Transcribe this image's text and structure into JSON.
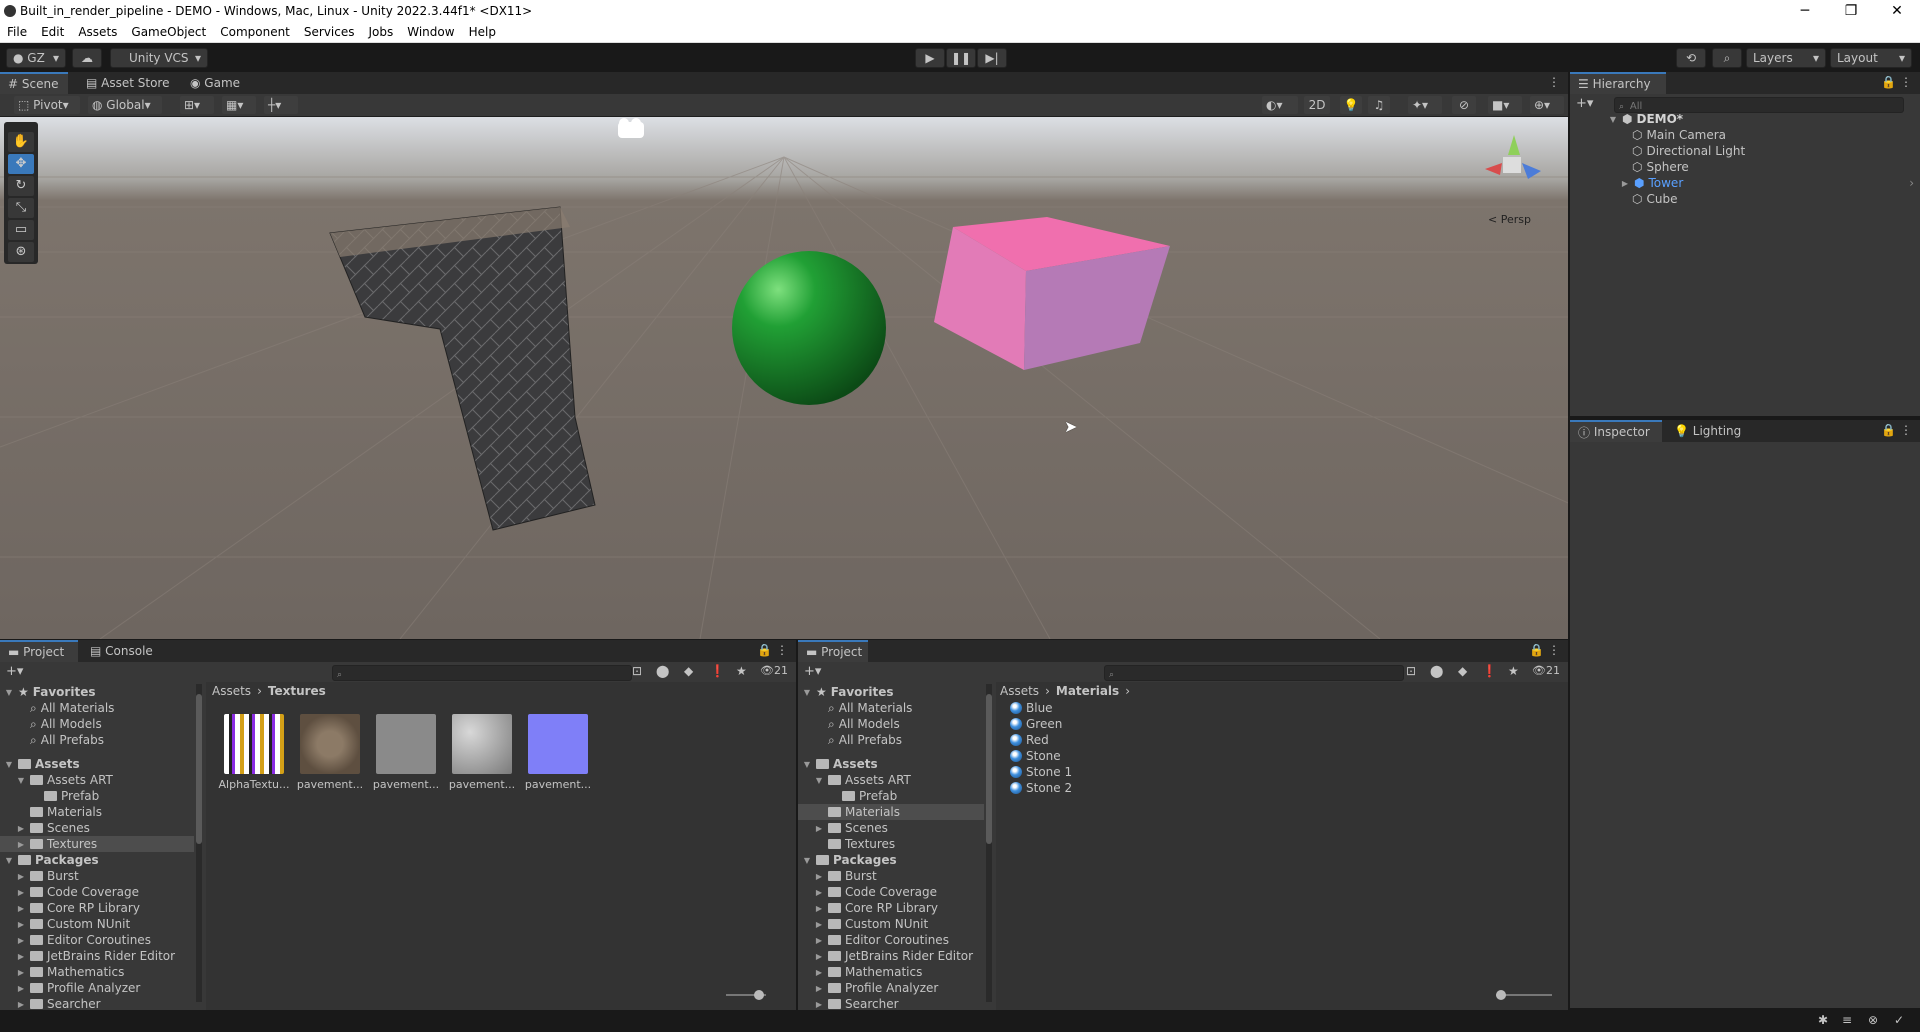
{
  "window": {
    "title": "Built_in_render_pipeline - DEMO - Windows, Mac, Linux - Unity 2022.3.44f1* <DX11>",
    "minimize": "─",
    "maximize": "❐",
    "close": "✕"
  },
  "menu": [
    "File",
    "Edit",
    "Assets",
    "GameObject",
    "Component",
    "Services",
    "Jobs",
    "Window",
    "Help"
  ],
  "toolbar": {
    "account": "GZ",
    "vcs": "Unity VCS",
    "layers": "Layers",
    "layout": "Layout"
  },
  "scene_tabs": [
    "Scene",
    "Asset Store",
    "Game"
  ],
  "scene_toolbar": {
    "pivot": "Pivot",
    "global": "Global",
    "mode2d": "2D",
    "persp": "< Persp"
  },
  "hierarchy": {
    "tab": "Hierarchy",
    "search_placeholder": "All",
    "scene": "DEMO*",
    "items": [
      "Main Camera",
      "Directional Light",
      "Sphere",
      "Tower",
      "Cube"
    ]
  },
  "inspector": {
    "tabs": [
      "Inspector",
      "Lighting"
    ]
  },
  "left_project": {
    "tabs": [
      "Project",
      "Console"
    ],
    "count": "21",
    "breadcrumb": [
      "Assets",
      "Textures"
    ],
    "favorites": {
      "label": "Favorites",
      "items": [
        "All Materials",
        "All Models",
        "All Prefabs"
      ]
    },
    "assets": {
      "label": "Assets",
      "items": [
        "Assets ART",
        "Prefab",
        "Materials",
        "Scenes",
        "Textures"
      ]
    },
    "packages": {
      "label": "Packages",
      "items": [
        "Burst",
        "Code Coverage",
        "Core RP Library",
        "Custom NUnit",
        "Editor Coroutines",
        "JetBrains Rider Editor",
        "Mathematics",
        "Profile Analyzer",
        "Searcher"
      ]
    },
    "thumbs": [
      {
        "label": "AlphaTextu..."
      },
      {
        "label": "pavement..."
      },
      {
        "label": "pavement..."
      },
      {
        "label": "pavement..."
      },
      {
        "label": "pavement..."
      }
    ]
  },
  "right_project": {
    "tab": "Project",
    "count": "21",
    "breadcrumb": [
      "Assets",
      "Materials"
    ],
    "favorites": {
      "label": "Favorites",
      "items": [
        "All Materials",
        "All Models",
        "All Prefabs"
      ]
    },
    "assets": {
      "label": "Assets",
      "items": [
        "Assets ART",
        "Prefab",
        "Materials",
        "Scenes",
        "Textures"
      ]
    },
    "packages": {
      "label": "Packages",
      "items": [
        "Burst",
        "Code Coverage",
        "Core RP Library",
        "Custom NUnit",
        "Editor Coroutines",
        "JetBrains Rider Editor",
        "Mathematics",
        "Profile Analyzer",
        "Searcher"
      ]
    },
    "materials": [
      "Blue",
      "Green",
      "Red",
      "Stone",
      "Stone 1",
      "Stone 2"
    ]
  }
}
